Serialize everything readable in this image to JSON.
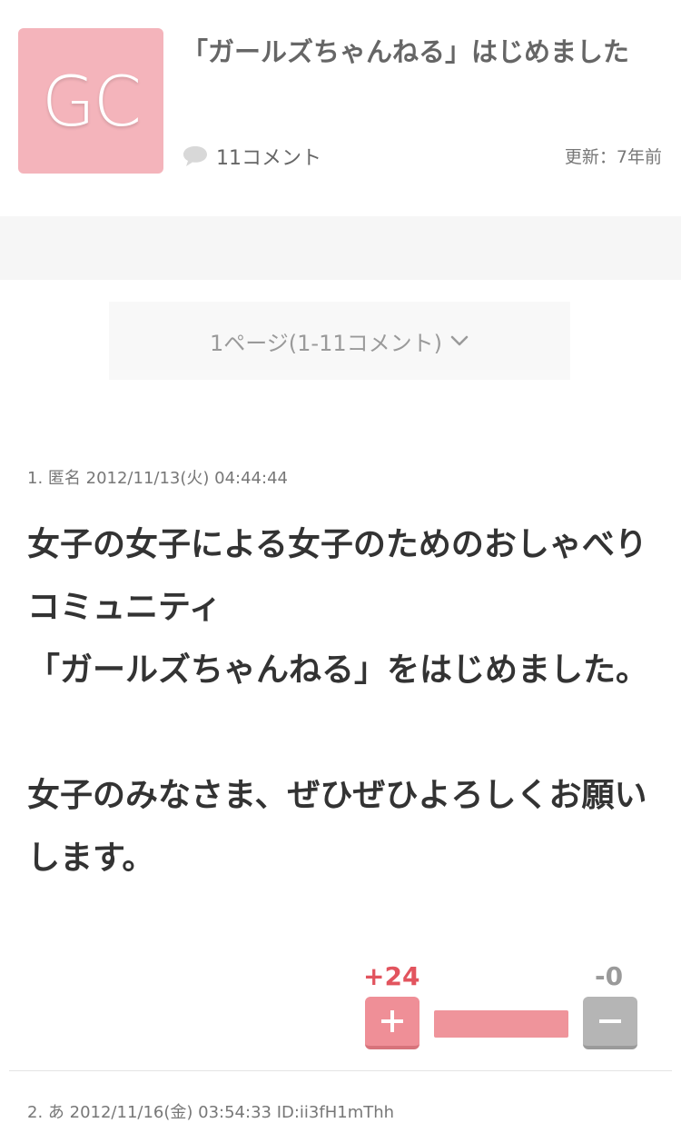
{
  "header": {
    "logo_text": "GC",
    "title": "「ガールズちゃんねる」はじめました",
    "comment_count": "11コメント",
    "updated": "更新：7年前"
  },
  "pager": {
    "label": "1ページ(1-11コメント)"
  },
  "comments": [
    {
      "meta": "1. 匿名 2012/11/13(火) 04:44:44",
      "body": "女子の女子による女子のためのおしゃべりコミュニティ\n「ガールズちゃんねる」をはじめました。\n\n女子のみなさま、ぜひぜひよろしくお願いします。",
      "plus": "+24",
      "minus": "-0",
      "plus_ratio": 1.0
    },
    {
      "meta": "2. あ 2012/11/16(金) 03:54:33 ID:ii3fH1mThh"
    }
  ],
  "colors": {
    "logo_bg": "#f4b4bb",
    "plus": "#e2545e",
    "plus_button": "#ef8f97",
    "minus_button": "#b5b5b5"
  },
  "icons": {
    "comment": "speech-bubble-icon",
    "pager": "chevron-down-icon",
    "plus": "plus-icon",
    "minus": "minus-icon"
  }
}
